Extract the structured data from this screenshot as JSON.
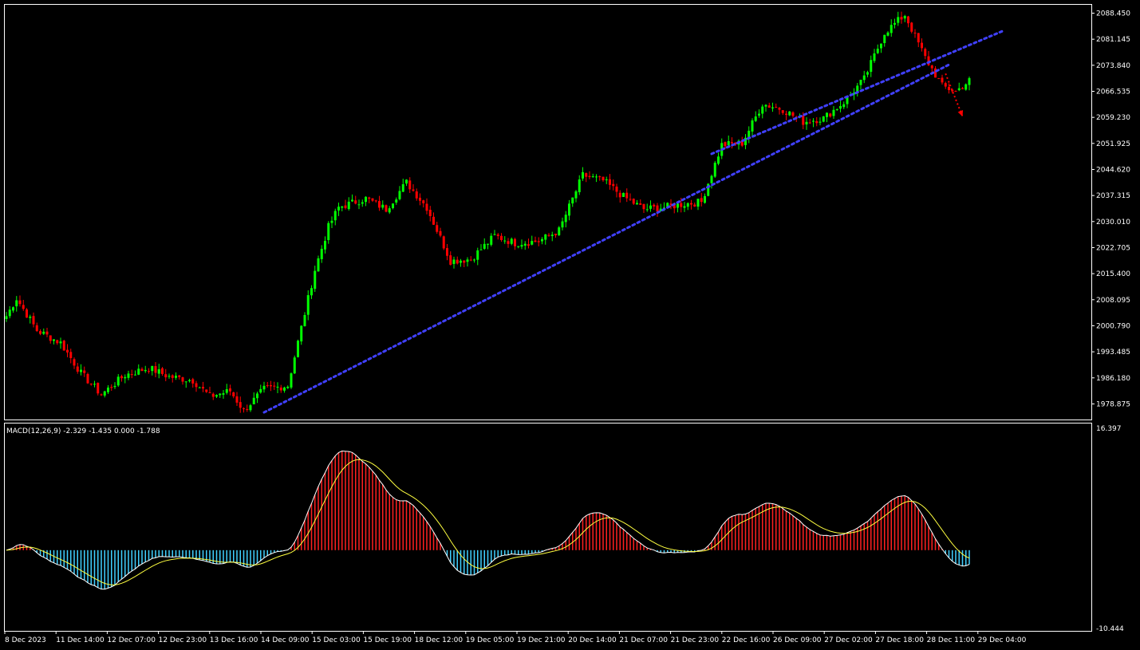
{
  "colors": {
    "background": "#000000",
    "frame": "#ffffff",
    "bull": "#00ff00",
    "bear": "#ff0000",
    "channel": "#4040ff",
    "arrow": "#ff0000",
    "macd_pos": "#ff2020",
    "macd_neg": "#40d0ff",
    "macd_line": "#ffffff",
    "signal_line": "#ffff40"
  },
  "chart_data": [
    {
      "type": "candlestick",
      "symbol_panel": "price",
      "y_ticks": [
        "2088.450",
        "2081.145",
        "2073.840",
        "2066.535",
        "2059.230",
        "2051.925",
        "2044.620",
        "2037.315",
        "2030.010",
        "2022.705",
        "2015.400",
        "2008.095",
        "2000.790",
        "1993.485",
        "1986.180",
        "1978.875"
      ],
      "ylim": [
        1974.5,
        2090.8
      ],
      "x_ticks": [
        "8 Dec 2023",
        "11 Dec 14:00",
        "12 Dec 07:00",
        "12 Dec 23:00",
        "13 Dec 16:00",
        "14 Dec 09:00",
        "15 Dec 03:00",
        "15 Dec 19:00",
        "18 Dec 12:00",
        "19 Dec 05:00",
        "19 Dec 21:00",
        "20 Dec 14:00",
        "21 Dec 07:00",
        "21 Dec 23:00",
        "22 Dec 16:00",
        "26 Dec 09:00",
        "27 Dec 02:00",
        "27 Dec 18:00",
        "28 Dec 11:00",
        "29 Dec 04:00"
      ],
      "bar_count": 240,
      "price_path": [
        [
          0,
          2003.5
        ],
        [
          3,
          2008.5
        ],
        [
          9,
          1999.5
        ],
        [
          16,
          1996.0
        ],
        [
          22,
          1987.5
        ],
        [
          28,
          1981.5
        ],
        [
          35,
          1987.0
        ],
        [
          42,
          1989.0
        ],
        [
          48,
          1986.5
        ],
        [
          55,
          1985.5
        ],
        [
          60,
          1981.0
        ],
        [
          66,
          1982.5
        ],
        [
          70,
          1977.0
        ],
        [
          76,
          1983.0
        ],
        [
          83,
          1984.0
        ],
        [
          91,
          2016.5
        ],
        [
          95,
          2028.5
        ],
        [
          98,
          2034.0
        ],
        [
          106,
          2036.5
        ],
        [
          112,
          2033.5
        ],
        [
          118,
          2041.0
        ],
        [
          124,
          2034.0
        ],
        [
          131,
          2019.0
        ],
        [
          137,
          2019.5
        ],
        [
          144,
          2026.0
        ],
        [
          150,
          2024.0
        ],
        [
          157,
          2024.5
        ],
        [
          163,
          2027.5
        ],
        [
          170,
          2043.0
        ],
        [
          176,
          2041.5
        ],
        [
          182,
          2037.0
        ],
        [
          188,
          2033.5
        ],
        [
          194,
          2034.0
        ],
        [
          200,
          2035.0
        ],
        [
          205,
          2035.5
        ],
        [
          211,
          2051.5
        ],
        [
          217,
          2052.0
        ],
        [
          223,
          2063.0
        ],
        [
          229,
          2061.5
        ],
        [
          235,
          2058.0
        ],
        [
          241,
          2059.0
        ],
        [
          247,
          2063.5
        ],
        [
          253,
          2070.0
        ],
        [
          259,
          2083.0
        ],
        [
          265,
          2088.0
        ],
        [
          271,
          2076.0
        ],
        [
          276,
          2068.0
        ],
        [
          280,
          2066.5
        ],
        [
          284,
          2069.5
        ]
      ],
      "path_x_units": "bar index 0-290 across visible window",
      "channel": {
        "upper": [
          [
            208,
            2049.0
          ],
          [
            294,
            2083.5
          ]
        ],
        "lower": [
          [
            76,
            1976.5
          ],
          [
            278,
            2074.0
          ]
        ]
      },
      "projection_arrow": {
        "from": [
          277,
          2071.5
        ],
        "to": [
          282,
          2059.5
        ],
        "direction": "down"
      }
    },
    {
      "type": "histogram+line",
      "label": "MACD(12,26,9) -2.329 -1.435 0.000 -1.788",
      "y_ticks": [
        "16.397",
        "-10.444"
      ],
      "ylim": [
        -10.444,
        16.397
      ],
      "series": [
        {
          "name": "MACD",
          "kind": "histogram"
        },
        {
          "name": "Signal",
          "kind": "line"
        }
      ]
    }
  ]
}
